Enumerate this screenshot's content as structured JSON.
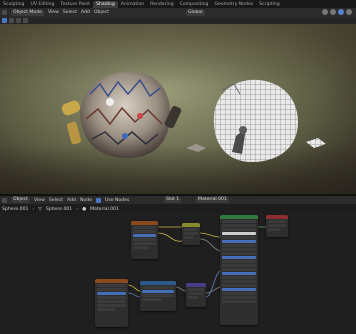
{
  "workspace_tabs": [
    "Sculpting",
    "UV Editing",
    "Texture Paint",
    "Shading",
    "Animation",
    "Rendering",
    "Compositing",
    "Geometry Nodes",
    "Scripting"
  ],
  "active_tab_index": 3,
  "viewport_header": {
    "mode": "Object Mode",
    "menus": [
      "View",
      "Select",
      "Add",
      "Object"
    ],
    "transform_orientation": "Global"
  },
  "node_header": {
    "object_type": "Object",
    "menus": [
      "View",
      "Select",
      "Add",
      "Node"
    ],
    "use_nodes_label": "Use Nodes",
    "slot": "Slot 1",
    "material": "Material.001"
  },
  "breadcrumb": {
    "object": "Sphere.001",
    "mesh": "Sphere.001",
    "material": "Material.001"
  },
  "colors": {
    "accent": "#4a78c4",
    "topbar": "#181818",
    "header": "#2b2b2b",
    "node_editor_bg": "#1f1f1f"
  },
  "icons": {
    "editor_type": "cube-icon",
    "viewport_shading": [
      "wireframe-shading-icon",
      "solid-shading-icon",
      "material-shading-icon",
      "rendered-shading-icon"
    ]
  }
}
